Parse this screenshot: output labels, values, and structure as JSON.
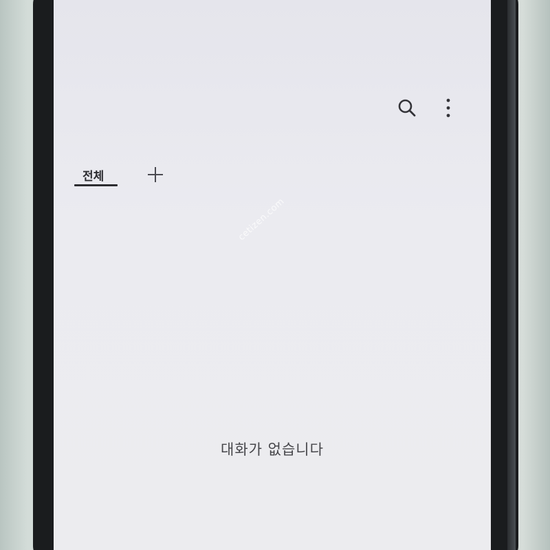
{
  "header": {
    "search_icon": "search-icon",
    "menu_icon": "more-vertical-icon"
  },
  "tabs": {
    "all_label": "전체",
    "add_icon": "plus-icon"
  },
  "main": {
    "empty_message": "대화가 없습니다"
  },
  "watermark": "cetizen.com",
  "colors": {
    "screen_background": "#ebebf0",
    "text_primary": "#2c2c30",
    "text_secondary": "#46464a"
  }
}
